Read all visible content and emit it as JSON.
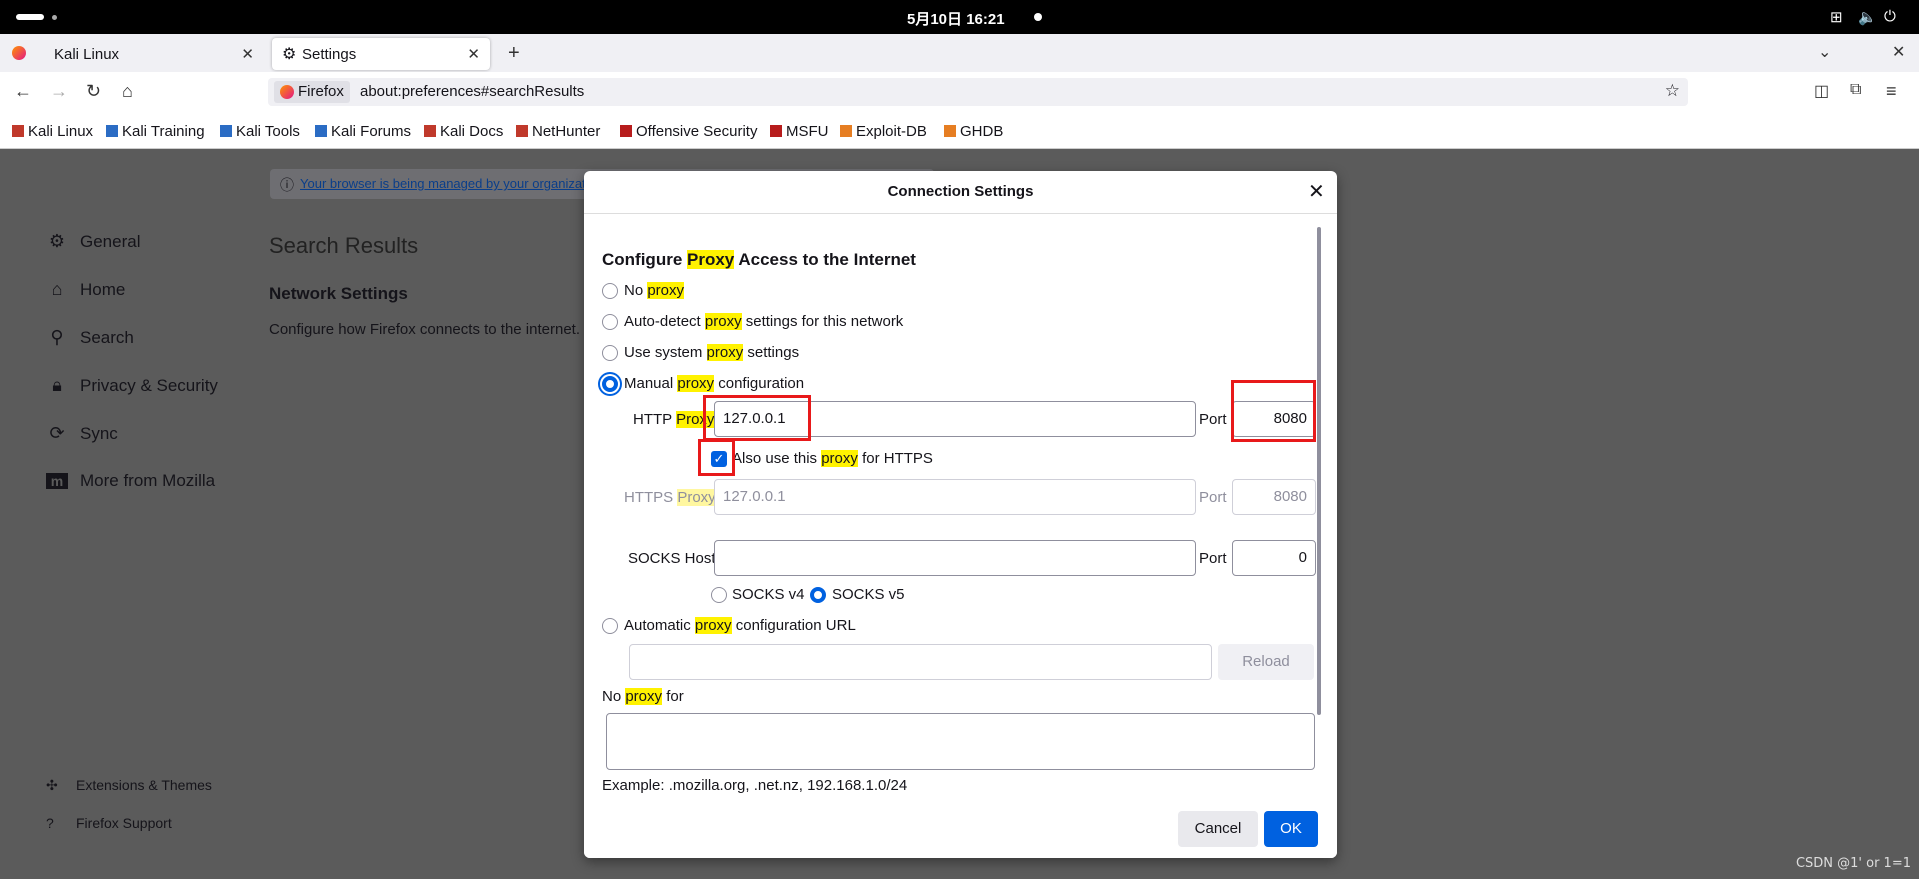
{
  "system_bar": {
    "clock": "5月10日 16:21"
  },
  "tabs": [
    {
      "label": "Kali Linux"
    },
    {
      "label": "Settings"
    }
  ],
  "urlbar": {
    "identity": "Firefox",
    "url": "about:preferences#searchResults"
  },
  "bookmarks": [
    "Kali Linux",
    "Kali Training",
    "Kali Tools",
    "Kali Forums",
    "Kali Docs",
    "NetHunter",
    "Offensive Security",
    "MSFU",
    "Exploit-DB",
    "GHDB"
  ],
  "page": {
    "managed_notice": "Your browser is being managed by your organizati",
    "search_results_title": "Search Results",
    "network_settings_title": "Network Settings",
    "network_settings_desc": "Configure how Firefox connects to the internet.",
    "sidebar": [
      {
        "label": "General",
        "icon": "gear-icon"
      },
      {
        "label": "Home",
        "icon": "home-icon"
      },
      {
        "label": "Search",
        "icon": "search-icon"
      },
      {
        "label": "Privacy & Security",
        "icon": "lock-icon"
      },
      {
        "label": "Sync",
        "icon": "sync-icon"
      },
      {
        "label": "More from Mozilla",
        "icon": "mozilla-icon"
      }
    ],
    "sidebar_bottom": [
      {
        "label": "Extensions & Themes",
        "icon": "puzzle-icon"
      },
      {
        "label": "Firefox Support",
        "icon": "help-icon"
      }
    ]
  },
  "dialog": {
    "title": "Connection Settings",
    "heading_pre": "Configure ",
    "heading_hl": "Proxy",
    "heading_post": " Access to the Internet",
    "options": {
      "no_proxy": {
        "pre": "No ",
        "hl": "proxy",
        "post": "",
        "selected": false
      },
      "auto_detect": {
        "pre": "Auto-detect ",
        "hl": "proxy",
        "post": " settings for this network",
        "selected": false
      },
      "system": {
        "pre": "Use system ",
        "hl": "proxy",
        "post": " settings",
        "selected": false
      },
      "manual": {
        "pre": "Manual ",
        "hl": "proxy",
        "post": " configuration",
        "selected": true
      },
      "auto_url": {
        "pre": "Automatic ",
        "hl": "proxy",
        "post": " configuration URL",
        "selected": false
      }
    },
    "http_proxy": {
      "label_pre": "HTTP ",
      "label_hl": "Proxy",
      "value": "127.0.0.1",
      "port_label": "Port",
      "port": "8080"
    },
    "also_https": {
      "pre": "Also use this ",
      "hl": "proxy",
      "post": " for HTTPS",
      "checked": true
    },
    "https_proxy": {
      "label_pre": "HTTPS ",
      "label_hl": "Proxy",
      "value": "127.0.0.1",
      "port_label": "Port",
      "port": "8080"
    },
    "socks": {
      "label": "SOCKS Host",
      "value": "",
      "port_label": "Port",
      "port": "0",
      "v4": "SOCKS v4",
      "v5": "SOCKS v5",
      "selected": "v5"
    },
    "reload_label": "Reload",
    "no_proxy_for": {
      "pre": "No ",
      "hl": "proxy",
      "post": " for"
    },
    "example": "Example: .mozilla.org, .net.nz, 192.168.1.0/24",
    "cancel": "Cancel",
    "ok": "OK"
  },
  "watermark": "CSDN @1' or 1=1"
}
